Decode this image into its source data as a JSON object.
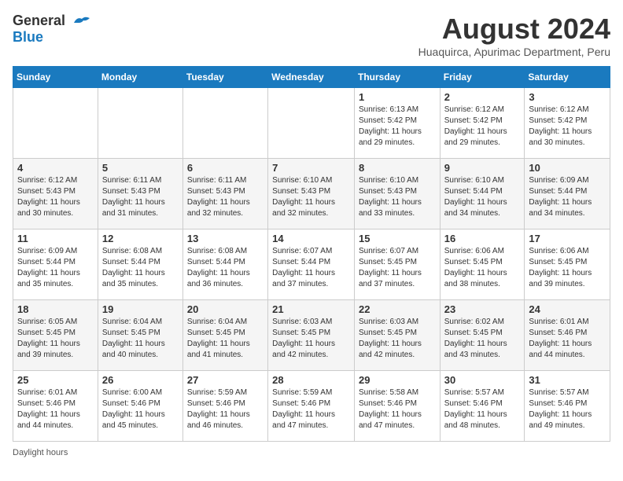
{
  "header": {
    "logo_general": "General",
    "logo_blue": "Blue",
    "title": "August 2024",
    "subtitle": "Huaquirca, Apurimac Department, Peru"
  },
  "days_of_week": [
    "Sunday",
    "Monday",
    "Tuesday",
    "Wednesday",
    "Thursday",
    "Friday",
    "Saturday"
  ],
  "weeks": [
    [
      {
        "day": "",
        "sunrise": "",
        "sunset": "",
        "daylight": ""
      },
      {
        "day": "",
        "sunrise": "",
        "sunset": "",
        "daylight": ""
      },
      {
        "day": "",
        "sunrise": "",
        "sunset": "",
        "daylight": ""
      },
      {
        "day": "",
        "sunrise": "",
        "sunset": "",
        "daylight": ""
      },
      {
        "day": "1",
        "sunrise": "Sunrise: 6:13 AM",
        "sunset": "Sunset: 5:42 PM",
        "daylight": "Daylight: 11 hours and 29 minutes."
      },
      {
        "day": "2",
        "sunrise": "Sunrise: 6:12 AM",
        "sunset": "Sunset: 5:42 PM",
        "daylight": "Daylight: 11 hours and 29 minutes."
      },
      {
        "day": "3",
        "sunrise": "Sunrise: 6:12 AM",
        "sunset": "Sunset: 5:42 PM",
        "daylight": "Daylight: 11 hours and 30 minutes."
      }
    ],
    [
      {
        "day": "4",
        "sunrise": "Sunrise: 6:12 AM",
        "sunset": "Sunset: 5:43 PM",
        "daylight": "Daylight: 11 hours and 30 minutes."
      },
      {
        "day": "5",
        "sunrise": "Sunrise: 6:11 AM",
        "sunset": "Sunset: 5:43 PM",
        "daylight": "Daylight: 11 hours and 31 minutes."
      },
      {
        "day": "6",
        "sunrise": "Sunrise: 6:11 AM",
        "sunset": "Sunset: 5:43 PM",
        "daylight": "Daylight: 11 hours and 32 minutes."
      },
      {
        "day": "7",
        "sunrise": "Sunrise: 6:10 AM",
        "sunset": "Sunset: 5:43 PM",
        "daylight": "Daylight: 11 hours and 32 minutes."
      },
      {
        "day": "8",
        "sunrise": "Sunrise: 6:10 AM",
        "sunset": "Sunset: 5:43 PM",
        "daylight": "Daylight: 11 hours and 33 minutes."
      },
      {
        "day": "9",
        "sunrise": "Sunrise: 6:10 AM",
        "sunset": "Sunset: 5:44 PM",
        "daylight": "Daylight: 11 hours and 34 minutes."
      },
      {
        "day": "10",
        "sunrise": "Sunrise: 6:09 AM",
        "sunset": "Sunset: 5:44 PM",
        "daylight": "Daylight: 11 hours and 34 minutes."
      }
    ],
    [
      {
        "day": "11",
        "sunrise": "Sunrise: 6:09 AM",
        "sunset": "Sunset: 5:44 PM",
        "daylight": "Daylight: 11 hours and 35 minutes."
      },
      {
        "day": "12",
        "sunrise": "Sunrise: 6:08 AM",
        "sunset": "Sunset: 5:44 PM",
        "daylight": "Daylight: 11 hours and 35 minutes."
      },
      {
        "day": "13",
        "sunrise": "Sunrise: 6:08 AM",
        "sunset": "Sunset: 5:44 PM",
        "daylight": "Daylight: 11 hours and 36 minutes."
      },
      {
        "day": "14",
        "sunrise": "Sunrise: 6:07 AM",
        "sunset": "Sunset: 5:44 PM",
        "daylight": "Daylight: 11 hours and 37 minutes."
      },
      {
        "day": "15",
        "sunrise": "Sunrise: 6:07 AM",
        "sunset": "Sunset: 5:45 PM",
        "daylight": "Daylight: 11 hours and 37 minutes."
      },
      {
        "day": "16",
        "sunrise": "Sunrise: 6:06 AM",
        "sunset": "Sunset: 5:45 PM",
        "daylight": "Daylight: 11 hours and 38 minutes."
      },
      {
        "day": "17",
        "sunrise": "Sunrise: 6:06 AM",
        "sunset": "Sunset: 5:45 PM",
        "daylight": "Daylight: 11 hours and 39 minutes."
      }
    ],
    [
      {
        "day": "18",
        "sunrise": "Sunrise: 6:05 AM",
        "sunset": "Sunset: 5:45 PM",
        "daylight": "Daylight: 11 hours and 39 minutes."
      },
      {
        "day": "19",
        "sunrise": "Sunrise: 6:04 AM",
        "sunset": "Sunset: 5:45 PM",
        "daylight": "Daylight: 11 hours and 40 minutes."
      },
      {
        "day": "20",
        "sunrise": "Sunrise: 6:04 AM",
        "sunset": "Sunset: 5:45 PM",
        "daylight": "Daylight: 11 hours and 41 minutes."
      },
      {
        "day": "21",
        "sunrise": "Sunrise: 6:03 AM",
        "sunset": "Sunset: 5:45 PM",
        "daylight": "Daylight: 11 hours and 42 minutes."
      },
      {
        "day": "22",
        "sunrise": "Sunrise: 6:03 AM",
        "sunset": "Sunset: 5:45 PM",
        "daylight": "Daylight: 11 hours and 42 minutes."
      },
      {
        "day": "23",
        "sunrise": "Sunrise: 6:02 AM",
        "sunset": "Sunset: 5:45 PM",
        "daylight": "Daylight: 11 hours and 43 minutes."
      },
      {
        "day": "24",
        "sunrise": "Sunrise: 6:01 AM",
        "sunset": "Sunset: 5:46 PM",
        "daylight": "Daylight: 11 hours and 44 minutes."
      }
    ],
    [
      {
        "day": "25",
        "sunrise": "Sunrise: 6:01 AM",
        "sunset": "Sunset: 5:46 PM",
        "daylight": "Daylight: 11 hours and 44 minutes."
      },
      {
        "day": "26",
        "sunrise": "Sunrise: 6:00 AM",
        "sunset": "Sunset: 5:46 PM",
        "daylight": "Daylight: 11 hours and 45 minutes."
      },
      {
        "day": "27",
        "sunrise": "Sunrise: 5:59 AM",
        "sunset": "Sunset: 5:46 PM",
        "daylight": "Daylight: 11 hours and 46 minutes."
      },
      {
        "day": "28",
        "sunrise": "Sunrise: 5:59 AM",
        "sunset": "Sunset: 5:46 PM",
        "daylight": "Daylight: 11 hours and 47 minutes."
      },
      {
        "day": "29",
        "sunrise": "Sunrise: 5:58 AM",
        "sunset": "Sunset: 5:46 PM",
        "daylight": "Daylight: 11 hours and 47 minutes."
      },
      {
        "day": "30",
        "sunrise": "Sunrise: 5:57 AM",
        "sunset": "Sunset: 5:46 PM",
        "daylight": "Daylight: 11 hours and 48 minutes."
      },
      {
        "day": "31",
        "sunrise": "Sunrise: 5:57 AM",
        "sunset": "Sunset: 5:46 PM",
        "daylight": "Daylight: 11 hours and 49 minutes."
      }
    ]
  ],
  "footer": {
    "daylight_label": "Daylight hours"
  }
}
